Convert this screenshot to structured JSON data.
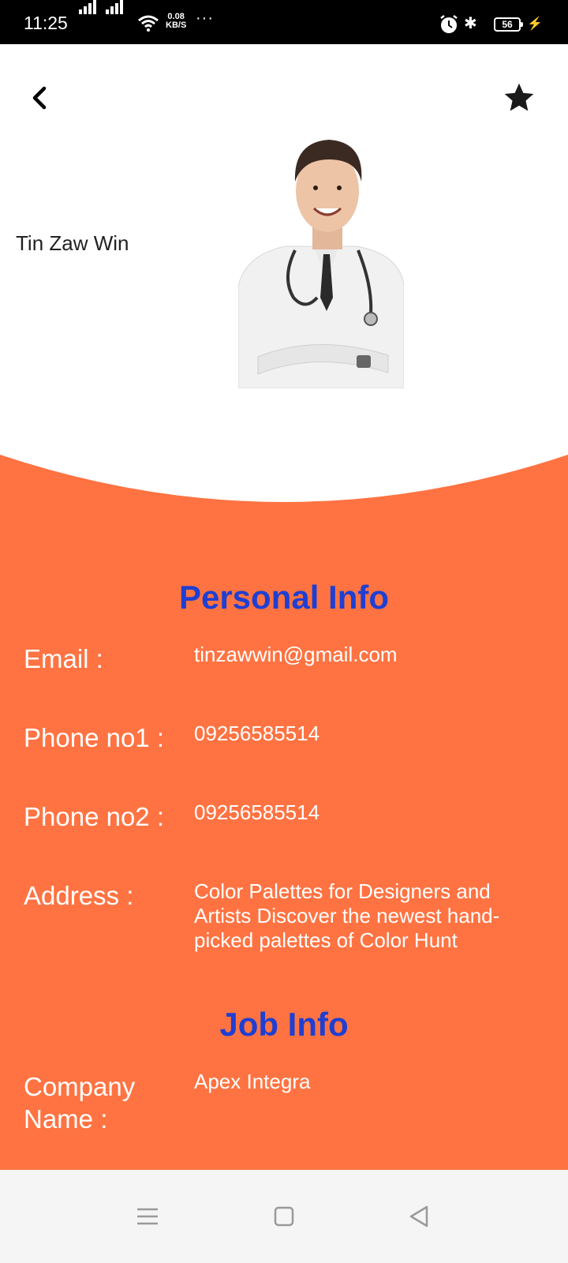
{
  "status_bar": {
    "time": "11:25",
    "net_speed_value": "0.08",
    "net_speed_unit": "KB/S",
    "more": "···",
    "battery": "56",
    "icons": [
      "signal-icon",
      "signal-icon",
      "wifi-icon",
      "alarm-icon",
      "bluetooth-icon",
      "battery-icon",
      "charging-icon"
    ]
  },
  "header": {
    "back_icon": "chevron-left-icon",
    "favorite_icon": "star-icon"
  },
  "profile": {
    "name": "Tin Zaw Win"
  },
  "personal_info": {
    "title": "Personal Info",
    "email_label": "Email :",
    "email_value": "tinzawwin@gmail.com",
    "phone1_label": "Phone no1 :",
    "phone1_value": "09256585514",
    "phone2_label": "Phone no2 :",
    "phone2_value": "09256585514",
    "address_label": "Address :",
    "address_value": "Color Palettes for Designers and Artists Discover the newest hand-picked palettes of Color Hunt"
  },
  "job_info": {
    "title": "Job Info",
    "company_label": "Company Name :",
    "company_value": "Apex Integra"
  },
  "nav_bar": {
    "icons": [
      "menu-icon",
      "home-square-icon",
      "back-triangle-icon"
    ]
  },
  "colors": {
    "accent_orange": "#ff7342",
    "title_blue": "#1f3fd2",
    "status_bar_bg": "#000000"
  }
}
